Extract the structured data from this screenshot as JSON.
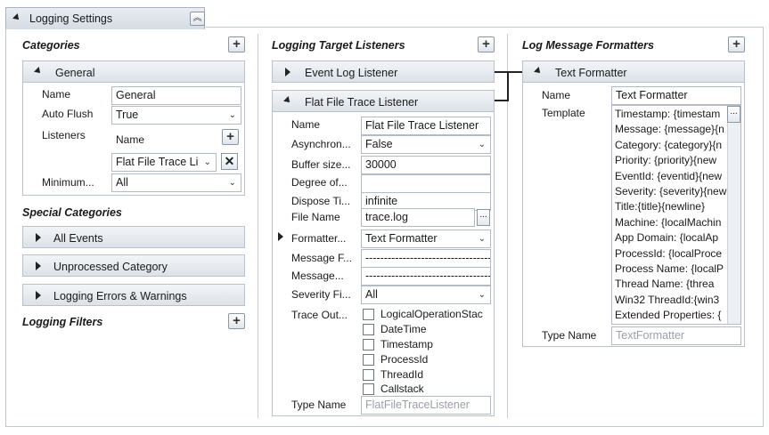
{
  "header": {
    "title": "Logging Settings",
    "collapse_icon": "double-chevron-up-icon"
  },
  "categories": {
    "heading": "Categories",
    "general": {
      "title": "General",
      "props": {
        "name_label": "Name",
        "name_value": "General",
        "autoflush_label": "Auto Flush",
        "autoflush_value": "True",
        "listeners_label": "Listeners",
        "listeners_name_label": "Name",
        "listener_value": "Flat File Trace Li",
        "minimum_label": "Minimum...",
        "minimum_value": "All"
      }
    },
    "special_heading": "Special Categories",
    "special_items": [
      "All Events",
      "Unprocessed Category",
      "Logging Errors & Warnings"
    ],
    "filters_heading": "Logging Filters"
  },
  "listeners": {
    "heading": "Logging Target Listeners",
    "event_log": {
      "title": "Event Log Listener"
    },
    "flat_file": {
      "title": "Flat File Trace Listener",
      "props": [
        {
          "label": "Name",
          "value": "Flat File Trace Listener",
          "kind": "text"
        },
        {
          "label": "Asynchron...",
          "value": "False",
          "kind": "dropdown"
        },
        {
          "label": "Buffer size...",
          "value": "30000",
          "kind": "text"
        },
        {
          "label": "Degree of...",
          "value": "",
          "kind": "text"
        },
        {
          "label": "Dispose Ti...",
          "value": "infinite",
          "kind": "text"
        },
        {
          "label": "File Name",
          "value": "trace.log",
          "kind": "ellipsis"
        },
        {
          "label": "Formatter...",
          "value": "Text Formatter",
          "kind": "dropdown"
        },
        {
          "label": "Message F...",
          "value": "-----------------------------------",
          "kind": "text"
        },
        {
          "label": "Message...",
          "value": "-----------------------------------",
          "kind": "text"
        },
        {
          "label": "Severity Fi...",
          "value": "All",
          "kind": "dropdown"
        }
      ],
      "trace_label": "Trace Out...",
      "trace_options": [
        "LogicalOperationStac",
        "DateTime",
        "Timestamp",
        "ProcessId",
        "ThreadId",
        "Callstack"
      ],
      "type_label": "Type Name",
      "type_value": "FlatFileTraceListener"
    }
  },
  "formatters": {
    "heading": "Log Message Formatters",
    "text_formatter": {
      "title": "Text Formatter",
      "name_label": "Name",
      "name_value": "Text Formatter",
      "template_label": "Template",
      "template_lines": [
        "Timestamp: {timestam",
        "Message: {message}{n",
        "Category: {category}{n",
        "Priority: {priority}{new",
        "EventId: {eventid}{new",
        "Severity: {severity}{new",
        "Title:{title}{newline}",
        "Machine: {localMachin",
        "App Domain: {localAp",
        "ProcessId: {localProce",
        "Process Name: {localP",
        "Thread Name: {threa",
        "Win32 ThreadId:{win3",
        "Extended Properties: {"
      ],
      "type_label": "Type Name",
      "type_value": "TextFormatter"
    }
  },
  "buttons": {
    "add_symbol": "+",
    "ellipsis": "...",
    "remove_symbol": "✕",
    "dropdown_symbol": "⌄"
  }
}
